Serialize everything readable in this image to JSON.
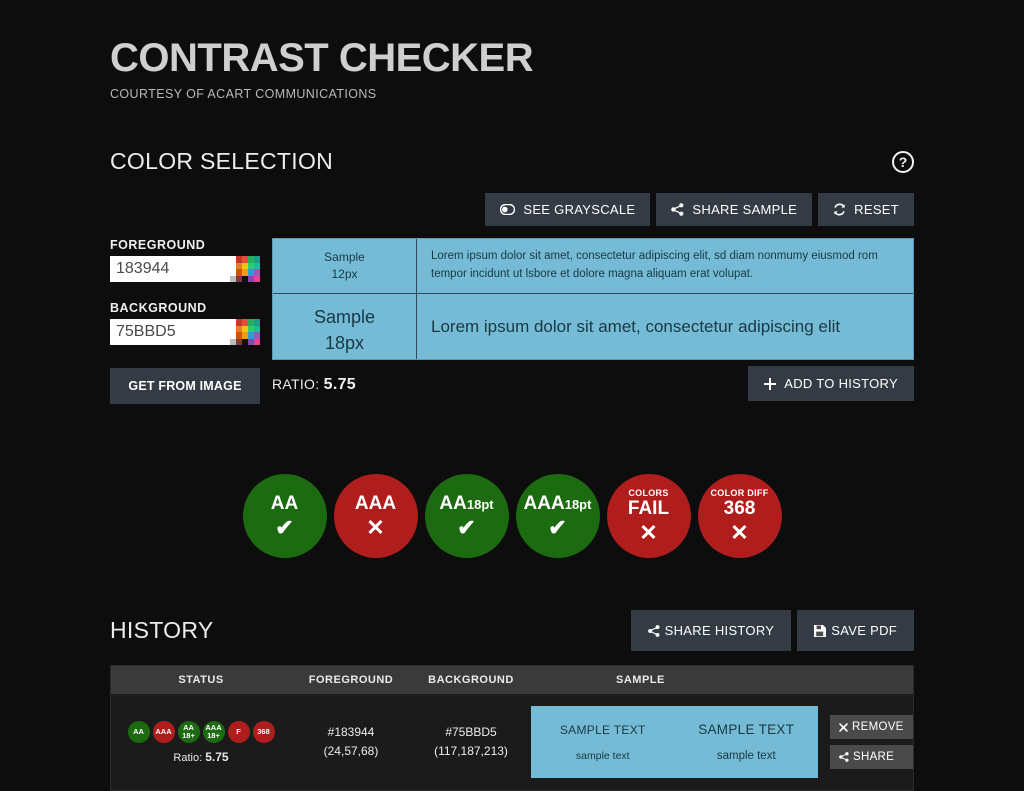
{
  "app": {
    "title": "CONTRAST CHECKER",
    "subtitle": "COURTESY OF ACART COMMUNICATIONS",
    "background_color": "#0d0d0d"
  },
  "color_selection": {
    "heading": "COLOR SELECTION",
    "help_glyph": "?",
    "toolbar": [
      {
        "label": "SEE GRAYSCALE",
        "icon": "toggle-icon"
      },
      {
        "label": "SHARE SAMPLE",
        "icon": "share-icon"
      },
      {
        "label": "RESET",
        "icon": "refresh-icon"
      }
    ],
    "foreground": {
      "label": "FOREGROUND",
      "value": "183944",
      "placeholder": "183944",
      "hex": "#183944",
      "rgb": "(24,57,68)"
    },
    "background": {
      "label": "BACKGROUND",
      "value": "75BBD5",
      "placeholder": "75BBD5",
      "hex": "#75BBD5",
      "rgb": "(117,187,213)"
    },
    "get_from_image_label": "GET FROM IMAGE",
    "ratio_label": "RATIO:",
    "ratio_value": "5.75",
    "add_to_history_label": "ADD TO HISTORY",
    "add_icon": "plus-icon"
  },
  "preview": {
    "small_title": "Sample",
    "small_size": "12px",
    "big_title": "Sample",
    "big_size": "18px",
    "body_small": "Lorem ipsum dolor sit amet, consectetur adipiscing elit, sd diam nonmumy eiusmod rom tempor incidunt ut lsbore et dolore magna aliquam erat volupat.",
    "body_big": "Lorem ipsum dolor sit amet, consectetur adipiscing elit"
  },
  "results": {
    "badges": [
      {
        "kicker": "",
        "label": "AA",
        "sub": "",
        "mark": "✔",
        "state": "pass"
      },
      {
        "kicker": "",
        "label": "AAA",
        "sub": "",
        "mark": "✕",
        "state": "fail"
      },
      {
        "kicker": "",
        "label": "AA",
        "sub": "18pt",
        "mark": "✔",
        "state": "pass"
      },
      {
        "kicker": "",
        "label": "AAA",
        "sub": "18pt",
        "mark": "✔",
        "state": "pass"
      },
      {
        "kicker": "COLORS",
        "label": "FAIL",
        "sub": "",
        "mark": "✕",
        "state": "fail"
      },
      {
        "kicker": "COLOR DIFF",
        "label": "368",
        "sub": "",
        "mark": "✕",
        "state": "fail"
      }
    ],
    "pass_color": "#1c6b10",
    "fail_color": "#b01d1d"
  },
  "history": {
    "heading": "HISTORY",
    "actions": [
      {
        "label": "SHARE HISTORY",
        "icon": "share-icon"
      },
      {
        "label": "SAVE PDF",
        "icon": "save-icon"
      }
    ],
    "columns": [
      "STATUS",
      "FOREGROUND",
      "BACKGROUND",
      "SAMPLE"
    ],
    "rows": [
      {
        "mini_badges": [
          {
            "line1": "AA",
            "line2": "",
            "state": "pass"
          },
          {
            "line1": "AAA",
            "line2": "",
            "state": "fail"
          },
          {
            "line1": "AA",
            "line2": "18+",
            "state": "pass"
          },
          {
            "line1": "AAA",
            "line2": "18+",
            "state": "pass"
          },
          {
            "line1": "F",
            "line2": "",
            "state": "fail"
          },
          {
            "line1": "368",
            "line2": "",
            "state": "fail"
          }
        ],
        "ratio_label": "Ratio:",
        "ratio_value": "5.75",
        "foreground_hex": "#183944",
        "foreground_rgb": "(24,57,68)",
        "background_hex": "#75BBD5",
        "background_rgb": "(117,187,213)",
        "sample_left_big": "SAMPLE TEXT",
        "sample_left_small": "sample text",
        "sample_right_big": "SAMPLE TEXT",
        "sample_right_small": "sample text",
        "remove_label": "REMOVE",
        "share_label": "SHARE"
      }
    ]
  }
}
